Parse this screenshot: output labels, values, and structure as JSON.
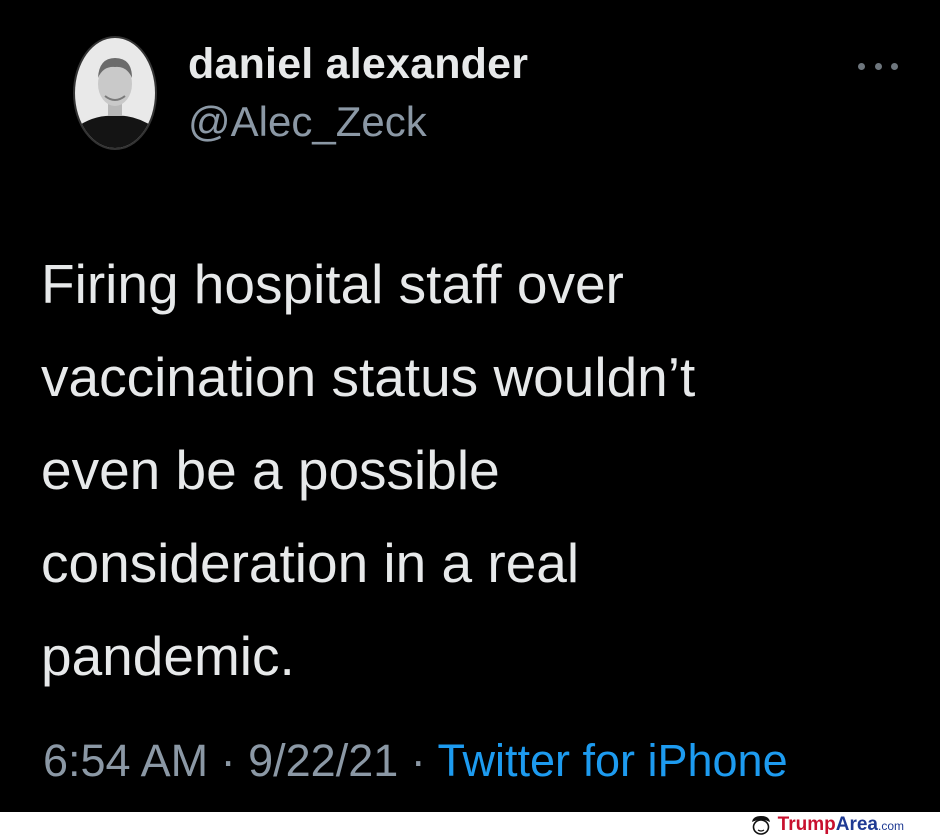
{
  "tweet": {
    "display_name": "daniel alexander",
    "handle": "@Alec_Zeck",
    "text_lines": [
      "Firing hospital staff over",
      "vaccination status wouldn’t",
      "even be a possible",
      "consideration in a real",
      "pandemic."
    ],
    "time": "6:54 AM",
    "separator": " · ",
    "date": "9/22/21",
    "source": "Twitter for iPhone"
  },
  "watermark": {
    "part1": "Trump",
    "part2": "Area",
    "part3": ".com"
  },
  "colors": {
    "background": "#000000",
    "text": "#e7e9ea",
    "muted": "#8b98a5",
    "link": "#1d9bf0"
  }
}
